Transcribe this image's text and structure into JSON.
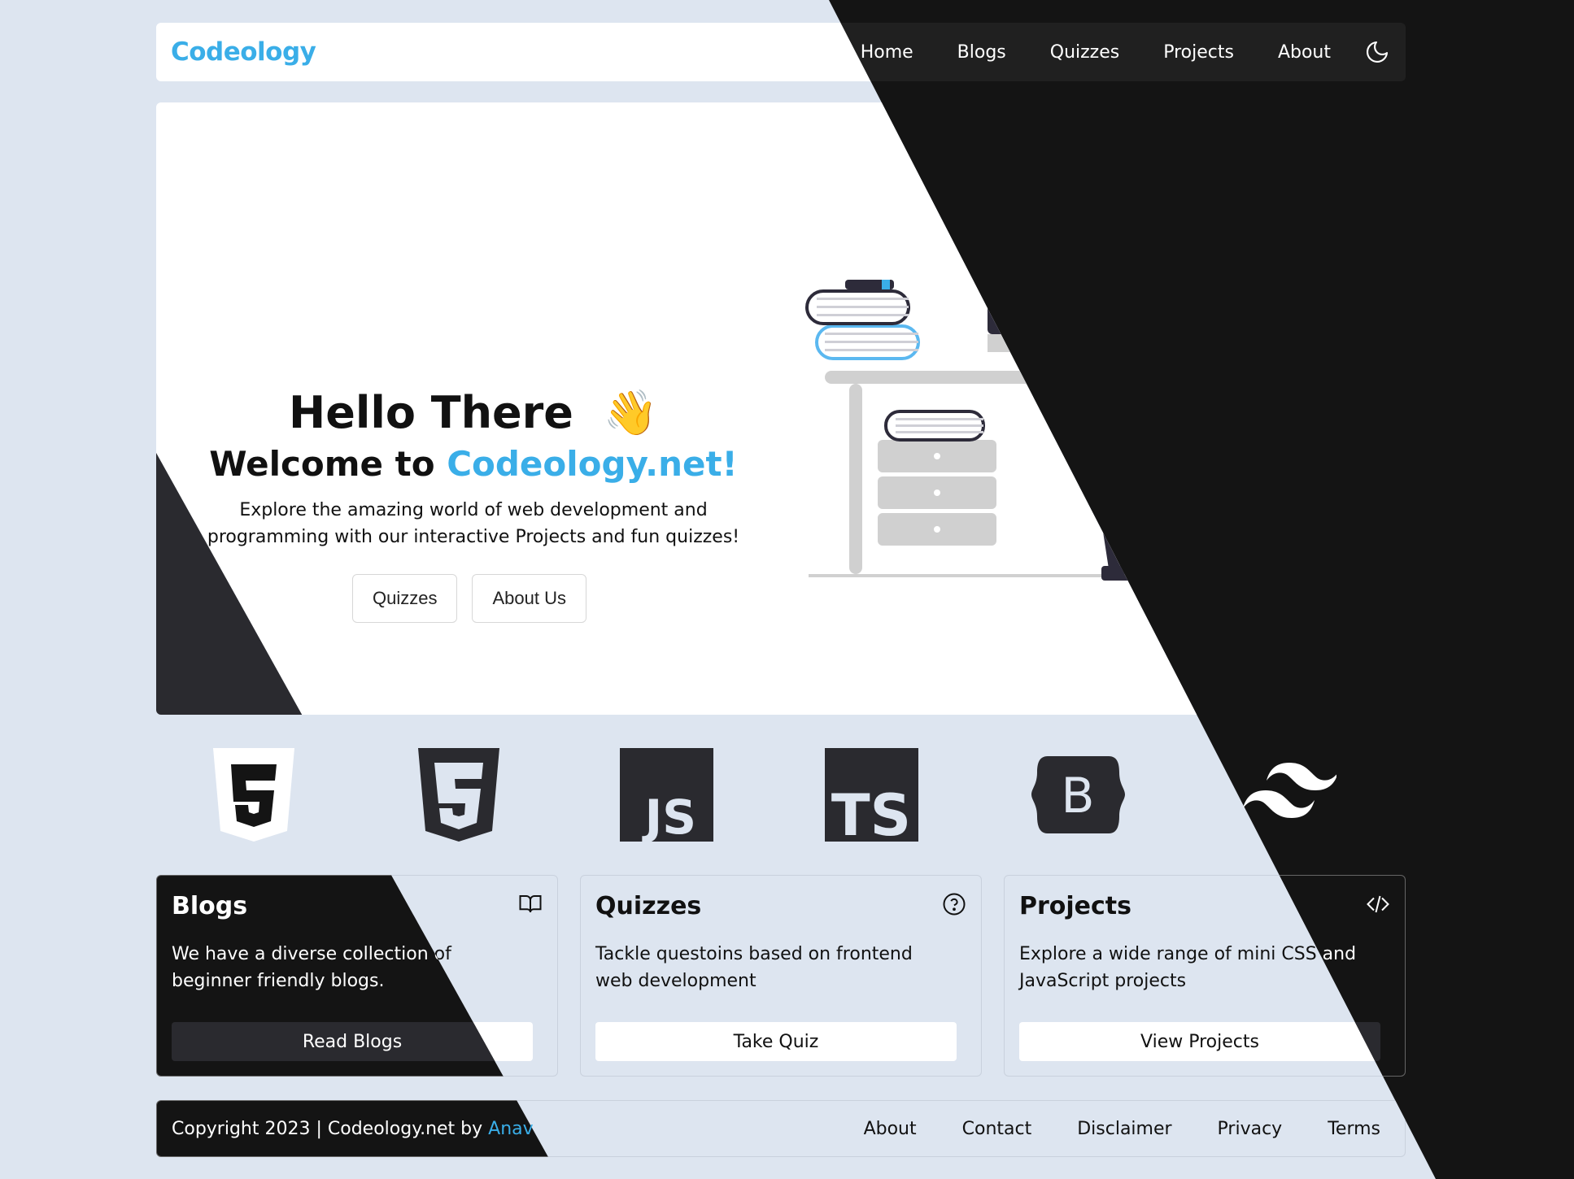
{
  "brand": {
    "name": "Codeology",
    "color": "#3aaee8"
  },
  "nav": {
    "links": [
      "Home",
      "Blogs",
      "Quizzes",
      "Projects",
      "About"
    ],
    "theme_toggle_icon": "moon-icon"
  },
  "hero": {
    "title": "Hello There",
    "wave_emoji": "👋",
    "subtitle_prefix": "Welcome to ",
    "subtitle_accent": "Codeology.net!",
    "description_line1": "Explore the amazing world of web development and",
    "description_line2": "programming with our interactive Projects and fun quizzes!",
    "buttons": [
      "Quizzes",
      "About Us"
    ]
  },
  "tech_icons": [
    "html5-icon",
    "css3-icon",
    "javascript-icon",
    "typescript-icon",
    "bootstrap-icon",
    "tailwind-icon"
  ],
  "cards": [
    {
      "title": "Blogs",
      "icon": "book-open-icon",
      "text_line1": "We have a diverse collection of",
      "text_line2": "beginner friendly blogs.",
      "button": "Read Blogs"
    },
    {
      "title": "Quizzes",
      "icon": "question-circle-icon",
      "text_line1": "Tackle questoins based on frontend",
      "text_line2": "web development",
      "button": "Take Quiz"
    },
    {
      "title": "Projects",
      "icon": "code-icon",
      "text_line1": "Explore a wide range of mini CSS and",
      "text_line2": "JavaScript projects",
      "button": "View Projects"
    }
  ],
  "footer": {
    "copyright_prefix": "Copyright 2023 | Codeology.net by ",
    "author": "Anav",
    "links": [
      "About",
      "Contact",
      "Disclaimer",
      "Privacy",
      "Terms"
    ]
  },
  "colors": {
    "accent": "#3aaee8",
    "light_bg": "#dde5f0",
    "dark_bg": "#141414"
  }
}
